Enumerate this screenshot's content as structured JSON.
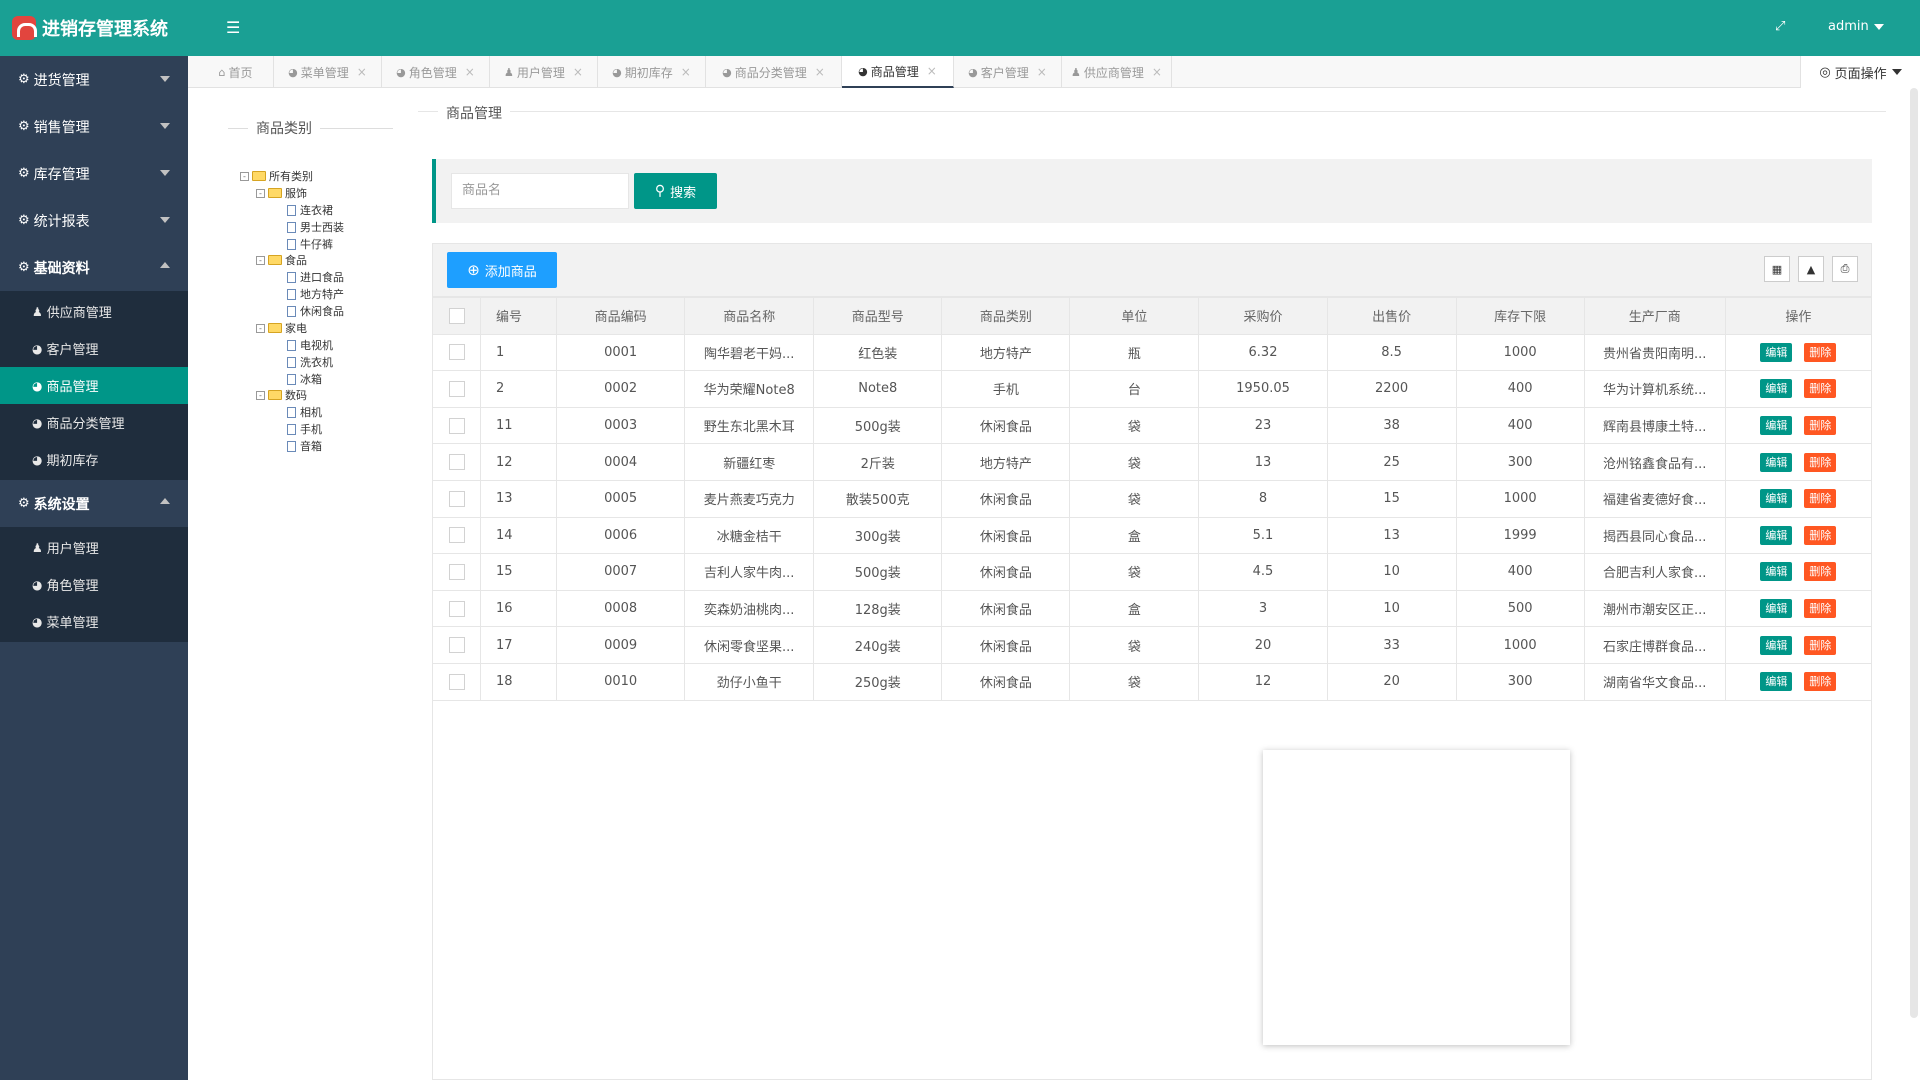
{
  "app": {
    "title": "进销存管理系统",
    "user": "admin"
  },
  "header": {
    "menu_icon": "menu-icon",
    "shrink_icon": "shrink-icon"
  },
  "sidebar": {
    "groups": [
      {
        "label": "进货管理",
        "open": false,
        "items": []
      },
      {
        "label": "销售管理",
        "open": false,
        "items": []
      },
      {
        "label": "库存管理",
        "open": false,
        "items": []
      },
      {
        "label": "统计报表",
        "open": false,
        "items": []
      },
      {
        "label": "基础资料",
        "open": true,
        "items": [
          "供应商管理",
          "客户管理",
          "商品管理",
          "商品分类管理",
          "期初库存"
        ],
        "active": "商品管理"
      },
      {
        "label": "系统设置",
        "open": true,
        "items": [
          "用户管理",
          "角色管理",
          "菜单管理"
        ]
      }
    ]
  },
  "tabs": [
    "首页",
    "菜单管理",
    "角色管理",
    "用户管理",
    "期初库存",
    "商品分类管理",
    "商品管理",
    "客户管理",
    "供应商管理"
  ],
  "active_tab": "商品管理",
  "page_ops_label": "页面操作",
  "category_panel": {
    "title": "商品类别",
    "tree": [
      {
        "label": "所有类别",
        "level": 0,
        "type": "folder-root"
      },
      {
        "label": "服饰",
        "level": 1,
        "type": "folder"
      },
      {
        "label": "连衣裙",
        "level": 2,
        "type": "file"
      },
      {
        "label": "男士西装",
        "level": 2,
        "type": "file"
      },
      {
        "label": "牛仔裤",
        "level": 2,
        "type": "file"
      },
      {
        "label": "食品",
        "level": 1,
        "type": "folder"
      },
      {
        "label": "进口食品",
        "level": 2,
        "type": "file"
      },
      {
        "label": "地方特产",
        "level": 2,
        "type": "file"
      },
      {
        "label": "休闲食品",
        "level": 2,
        "type": "file"
      },
      {
        "label": "家电",
        "level": 1,
        "type": "folder"
      },
      {
        "label": "电视机",
        "level": 2,
        "type": "file"
      },
      {
        "label": "洗衣机",
        "level": 2,
        "type": "file"
      },
      {
        "label": "冰箱",
        "level": 2,
        "type": "file"
      },
      {
        "label": "数码",
        "level": 1,
        "type": "folder"
      },
      {
        "label": "相机",
        "level": 2,
        "type": "file"
      },
      {
        "label": "手机",
        "level": 2,
        "type": "file"
      },
      {
        "label": "音箱",
        "level": 2,
        "type": "file"
      }
    ]
  },
  "main": {
    "legend": "商品管理",
    "search": {
      "placeholder": "商品名",
      "button": "搜索"
    },
    "add_button": "添加商品",
    "columns": [
      "编号",
      "商品编码",
      "商品名称",
      "商品型号",
      "商品类别",
      "单位",
      "采购价",
      "出售价",
      "库存下限",
      "生产厂商",
      "操作"
    ],
    "rows": [
      [
        "1",
        "0001",
        "陶华碧老干妈...",
        "红色装",
        "地方特产",
        "瓶",
        "6.32",
        "8.5",
        "1000",
        "贵州省贵阳南明..."
      ],
      [
        "2",
        "0002",
        "华为荣耀Note8",
        "Note8",
        "手机",
        "台",
        "1950.05",
        "2200",
        "400",
        "华为计算机系统..."
      ],
      [
        "11",
        "0003",
        "野生东北黑木耳",
        "500g装",
        "休闲食品",
        "袋",
        "23",
        "38",
        "400",
        "辉南县博康土特..."
      ],
      [
        "12",
        "0004",
        "新疆红枣",
        "2斤装",
        "地方特产",
        "袋",
        "13",
        "25",
        "300",
        "沧州铭鑫食品有..."
      ],
      [
        "13",
        "0005",
        "麦片燕麦巧克力",
        "散装500克",
        "休闲食品",
        "袋",
        "8",
        "15",
        "1000",
        "福建省麦德好食..."
      ],
      [
        "14",
        "0006",
        "冰糖金桔干",
        "300g装",
        "休闲食品",
        "盒",
        "5.1",
        "13",
        "1999",
        "揭西县同心食品..."
      ],
      [
        "15",
        "0007",
        "吉利人家牛肉...",
        "500g装",
        "休闲食品",
        "袋",
        "4.5",
        "10",
        "400",
        "合肥吉利人家食..."
      ],
      [
        "16",
        "0008",
        "奕森奶油桃肉...",
        "128g装",
        "休闲食品",
        "盒",
        "3",
        "10",
        "500",
        "潮州市潮安区正..."
      ],
      [
        "17",
        "0009",
        "休闲零食坚果...",
        "240g装",
        "休闲食品",
        "袋",
        "20",
        "33",
        "1000",
        "石家庄博群食品..."
      ],
      [
        "18",
        "0010",
        "劲仔小鱼干",
        "250g装",
        "休闲食品",
        "袋",
        "12",
        "20",
        "300",
        "湖南省华文食品..."
      ]
    ],
    "row_actions": {
      "edit": "编辑",
      "delete": "删除"
    }
  },
  "colors": {
    "header": "#1aa094",
    "sidebar": "#2f4056",
    "active": "#009688",
    "edit": "#009688",
    "delete": "#ff5722",
    "add": "#1e9fff"
  }
}
